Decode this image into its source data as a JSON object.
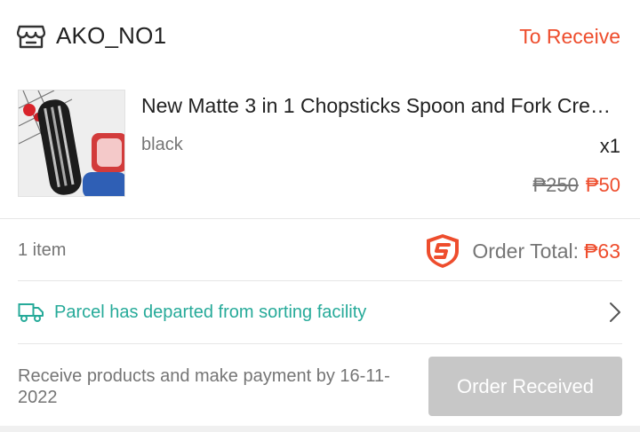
{
  "shop": {
    "name": "AKO_NO1",
    "status": "To Receive",
    "icon": "store-icon"
  },
  "product": {
    "title": "New Matte 3 in 1 Chopsticks Spoon and Fork Cre…",
    "variant": "black",
    "quantity": "x1",
    "price_original": "₱250",
    "price_current": "₱50",
    "thumbnail": "cutlery-case-photo"
  },
  "summary": {
    "item_count": "1 item",
    "total_label": "Order Total:",
    "total_value": "₱63",
    "guarantee_icon": "shield-guarantee-icon"
  },
  "tracking": {
    "status_text": "Parcel has departed from sorting facility",
    "icon": "truck-icon"
  },
  "footer": {
    "deadline_text": "Receive products and make payment by 16-11-2022",
    "button_label": "Order Received"
  },
  "colors": {
    "accent": "#ee4d2d",
    "tracking": "#26aa99",
    "muted_text": "#757575",
    "button_disabled": "#c7c7c7"
  }
}
